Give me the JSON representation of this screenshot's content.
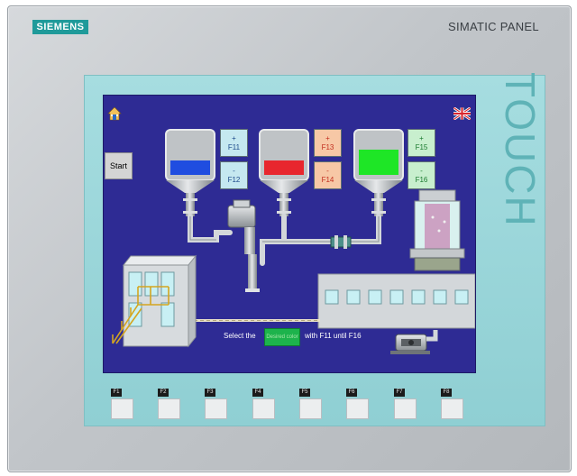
{
  "bezel": {
    "brand": "SIEMENS",
    "model": "SIMATIC PANEL",
    "side_label": "TOUCH"
  },
  "screen": {
    "start_button": "Start",
    "fbuttons": [
      {
        "sign": "+",
        "key": "F11",
        "color": "blue"
      },
      {
        "sign": "-",
        "key": "F12",
        "color": "blue"
      },
      {
        "sign": "+",
        "key": "F13",
        "color": "red"
      },
      {
        "sign": "-",
        "key": "F14",
        "color": "red"
      },
      {
        "sign": "+",
        "key": "F15",
        "color": "green"
      },
      {
        "sign": "-",
        "key": "F16",
        "color": "green"
      }
    ],
    "hint_prefix": "Select the",
    "hint_color_label": "Desired color",
    "hint_suffix": "with F11 until F16",
    "tank_colors": [
      "#1f4de0",
      "#e8262e",
      "#1ee626"
    ]
  },
  "function_keys": [
    "F1",
    "F2",
    "F3",
    "F4",
    "F5",
    "F6",
    "F7",
    "F8"
  ],
  "icons": {
    "home": "home-icon",
    "language": "uk-flag-icon"
  },
  "colors": {
    "screen_bg": "#2e2b94",
    "brand": "#1f9a9a",
    "frame": "#9fd8dc"
  }
}
